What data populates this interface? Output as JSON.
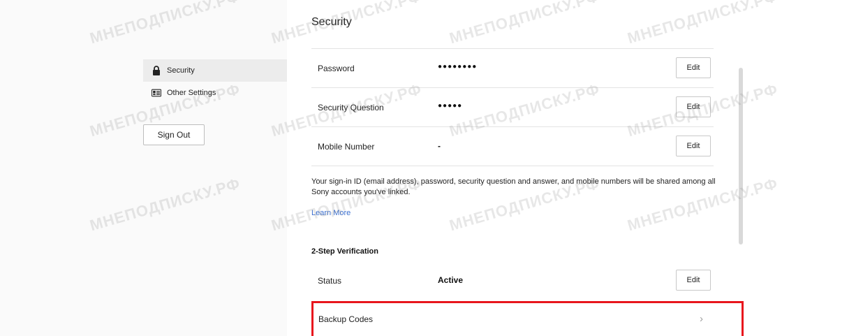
{
  "sidebar": {
    "items": [
      {
        "label": "Security",
        "icon": "lock-icon",
        "active": true
      },
      {
        "label": "Other Settings",
        "icon": "id-card-icon",
        "active": false
      }
    ],
    "sign_out_label": "Sign Out"
  },
  "main": {
    "title": "Security",
    "rows": [
      {
        "label": "Password",
        "value": "●●●●●●●●",
        "button": "Edit"
      },
      {
        "label": "Security Question",
        "value": "●●●●●",
        "button": "Edit"
      },
      {
        "label": "Mobile Number",
        "value": "-",
        "button": "Edit"
      }
    ],
    "info_text": "Your sign-in ID (email address), password, security question and answer, and mobile numbers will be shared among all Sony accounts you've linked.",
    "learn_more": "Learn More",
    "two_step": {
      "heading": "2-Step Verification",
      "status_label": "Status",
      "status_value": "Active",
      "status_button": "Edit",
      "backup_label": "Backup Codes",
      "backup_chevron": "›"
    }
  },
  "highlight_color": "#e8161d",
  "link_color": "#3b6fcf",
  "watermark": {
    "text_a": "МНЕПОДПИСКУ.РФ",
    "text_b": "МНЕПОДПИСКУ.РФ",
    "text_c": "МНЕПОДПИСКУ.РФ",
    "text_d": "МНЕПОДПИСКУ.РФ",
    "text_e": "МНЕПОДПИСКУ.РФ",
    "text_f": "МНЕПОДПИСКУ.РФ",
    "text_g": "МНЕПОДПИСКУ.РФ",
    "text_h": "МНЕПОДПИСКУ.РФ",
    "text_i": "МНЕПОДПИСКУ.РФ",
    "text_j": "МНЕПОДПИСКУ.РФ",
    "text_k": "МНЕПОДПИСКУ.РФ",
    "text_l": "МНЕПОДПИСКУ.РФ"
  }
}
